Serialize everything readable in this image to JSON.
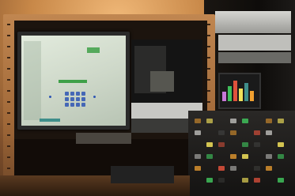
{
  "photo": {
    "subject": "",
    "colors": {
      "wood": "#b07840",
      "wood_dark": "#6b4426",
      "wall_glow": "#e0a060",
      "monitor_frame": "#2a2a2a",
      "monitor_screen": "#d2dccd",
      "screen_green": "#3ea048",
      "screen_teal": "#3f8e8a",
      "screen_blue": "#2e55b4",
      "rack_dark": "#141414",
      "rack_mid": "#3a3a38",
      "rack_silver": "#c8c8c4",
      "led_red": "#e0523c",
      "led_orange": "#f0a030",
      "led_yellow": "#f2e25a",
      "led_green": "#3fbf5a",
      "led_purple": "#c878d8"
    }
  }
}
